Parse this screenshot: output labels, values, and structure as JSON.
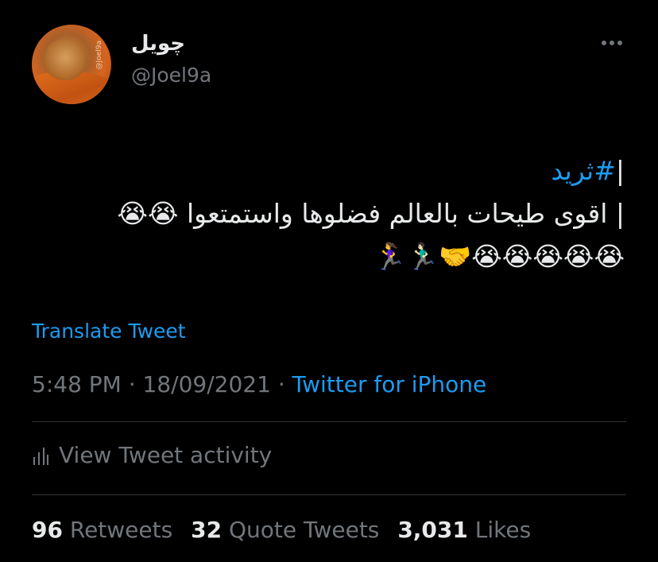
{
  "user": {
    "display_name": "چويل",
    "handle": "@Joel9a",
    "avatar_watermark": "@Joel9a"
  },
  "tweet": {
    "hashtag": "#ثريد",
    "line1_marker": "|",
    "line2_text": "| اقوى طيحات بالعالم فضلوها واستمتعوا 😭😭",
    "line3_text": "😭😭😭😭😭🤝🏃🏻‍♂️🏃‍♀️"
  },
  "translate_label": "Translate Tweet",
  "meta": {
    "time": "5:48 PM",
    "separator": " · ",
    "date": "18/09/2021",
    "separator2": " · ",
    "source": "Twitter for iPhone"
  },
  "activity_label": "View Tweet activity",
  "stats": {
    "retweets_count": "96",
    "retweets_label": "Retweets",
    "quotes_count": "32",
    "quotes_label": "Quote Tweets",
    "likes_count": "3,031",
    "likes_label": "Likes"
  },
  "colors": {
    "background": "#000000",
    "text": "#e7e9ea",
    "secondary": "#71767b",
    "accent": "#1d9bf0",
    "divider": "#2f3336"
  },
  "icons": {
    "more": "more-horizontal-icon",
    "activity": "bar-chart-icon"
  }
}
